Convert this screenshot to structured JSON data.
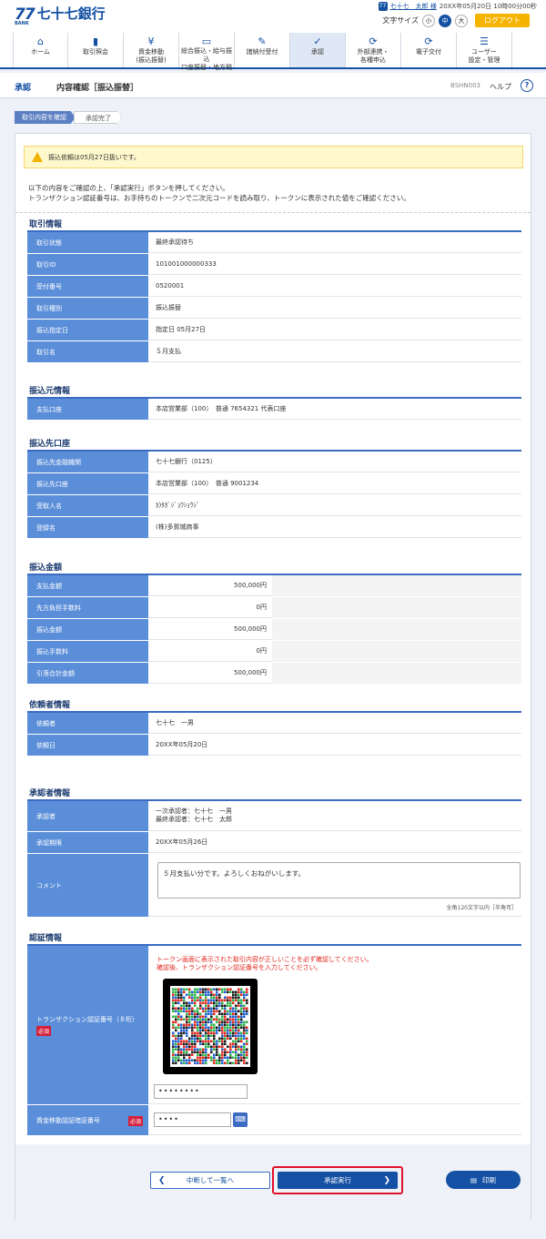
{
  "header": {
    "logo_mark": "77",
    "logo_bank": "BANK",
    "logo_name": "七十七銀行",
    "user_name": "七十七　太郎 様",
    "datetime": "20XX年05月20日 10時00分00秒",
    "font_size_label": "文字サイズ",
    "size_small": "小",
    "size_mid": "中",
    "size_large": "大",
    "logout": "ログアウト"
  },
  "nav": [
    {
      "icon": "home-icon",
      "glyph": "⌂",
      "label": "ホーム"
    },
    {
      "icon": "document-icon",
      "glyph": "▮",
      "label": "取引照会"
    },
    {
      "icon": "yen-icon",
      "glyph": "¥",
      "label": "資金移動\n(振込振替)"
    },
    {
      "icon": "card-icon",
      "glyph": "▭",
      "label": "総合振込・給与振込\n口座振替・地方税"
    },
    {
      "icon": "payment-icon",
      "glyph": "✎",
      "label": "諸納付受付"
    },
    {
      "icon": "approval-icon",
      "glyph": "✓",
      "label": "承認"
    },
    {
      "icon": "link-icon",
      "glyph": "⟳",
      "label": "外部連携・\n各種申込"
    },
    {
      "icon": "digital-icon",
      "glyph": "⟳",
      "label": "電子交付"
    },
    {
      "icon": "user-settings-icon",
      "glyph": "☰",
      "label": "ユーザー\n設定・管理"
    }
  ],
  "title": {
    "section": "承認",
    "title": "内容確認［振込振替］",
    "code": "BSHN003",
    "help": "ヘルプ",
    "help_icon": "?"
  },
  "steps": [
    "取引内容を確認",
    "承認完了"
  ],
  "alert": "振込依頼は05月27日扱いです。",
  "intro": [
    "以下の内容をご確認の上、「承認実行」ボタンを押してください。",
    "トランザクション認証番号は、お手持ちのトークンで二次元コードを読み取り、トークンに表示された値をご確認ください。"
  ],
  "sections": {
    "torihiki": {
      "title": "取引情報",
      "rows": [
        [
          "取引状態",
          "最終承認待ち"
        ],
        [
          "取引ID",
          "101001000000333"
        ],
        [
          "受付番号",
          "0520001"
        ],
        [
          "取引種別",
          "振込振替"
        ],
        [
          "振込指定日",
          "指定日 05月27日"
        ],
        [
          "取引名",
          "５月支払"
        ]
      ]
    },
    "moto": {
      "title": "振込元情報",
      "rows": [
        [
          "支払口座",
          "本店営業部（100）　普通 7654321 代表口座"
        ]
      ]
    },
    "saki": {
      "title": "振込先口座",
      "rows": [
        [
          "振込先金融機関",
          "七十七銀行（0125）"
        ],
        [
          "振込先口座",
          "本店営業部（100）　普通 9001234"
        ],
        [
          "受取人名",
          "ｶ)ﾀｶﾞｼﾞｮｳｼｮｳｼﾞ"
        ],
        [
          "登録名",
          "(株)多賀城商事"
        ]
      ]
    },
    "kingaku": {
      "title": "振込金額",
      "rows": [
        [
          "支払金額",
          "500,000円"
        ],
        [
          "先方負担手数料",
          "0円"
        ],
        [
          "振込金額",
          "500,000円"
        ],
        [
          "振込手数料",
          "0円"
        ],
        [
          "引落合計金額",
          "500,000円"
        ]
      ]
    },
    "irai": {
      "title": "依頼者情報",
      "rows": [
        [
          "依頼者",
          "七十七　一男"
        ],
        [
          "依頼日",
          "20XX年05月20日"
        ]
      ]
    },
    "shonin": {
      "title": "承認者情報",
      "approver_label": "承認者",
      "approver_lines": [
        "一次承認者：七十七　一男",
        "最終承認者：七十七　太郎"
      ],
      "deadline_label": "承認期限",
      "deadline": "20XX年05月26日",
      "comment_label": "コメント",
      "comment": "５月支払い分です。よろしくおねがいします。",
      "comment_hint": "全角120文字以内［半角可］"
    },
    "ninsho": {
      "title": "認証情報",
      "tx_label": "トランザクション認証番号（８桁）",
      "required": "必須",
      "notice": [
        "トークン画面に表示された取引内容が正しいことを必ず確認してください。",
        "確認後、トランザクション認証番号を入力してください。"
      ],
      "tx_value": "••••••••",
      "pw_label": "資金移動認証暗証番号",
      "pw_value": "••••",
      "keyboard_icon": "keyboard-icon"
    }
  },
  "buttons": {
    "back": "中断して一覧へ",
    "exec": "承認実行",
    "print": "印刷"
  },
  "colors": {
    "brand": "#1450a3",
    "header_cell": "#5b8ed9",
    "required": "#d4203b",
    "highlight": "#e0102a"
  }
}
